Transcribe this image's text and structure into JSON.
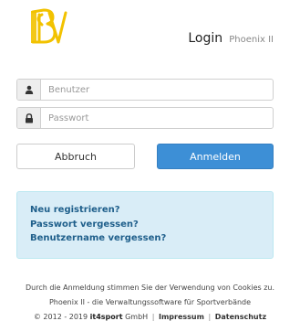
{
  "header": {
    "title": "Login",
    "subtitle": "Phoenix II",
    "logo_name": "bsv-logo"
  },
  "form": {
    "username": {
      "placeholder": "Benutzer",
      "value": "",
      "icon": "user-icon"
    },
    "password": {
      "placeholder": "Passwort",
      "value": "",
      "icon": "lock-icon"
    },
    "cancel_label": "Abbruch",
    "login_label": "Anmelden"
  },
  "links": {
    "register": "Neu registrieren?",
    "forgot_password": "Passwort vergessen?",
    "forgot_username": "Benutzername vergessen?"
  },
  "footer": {
    "cookie_notice": "Durch die Anmeldung stimmen Sie der Verwendung von Cookies zu.",
    "tagline": "Phoenix II - die Verwaltungssoftware für Sportverbände",
    "copyright": "© 2012 - 2019",
    "brand_bold": "it4sport",
    "brand_rest": "GmbH",
    "separator": "|",
    "impressum": "Impressum",
    "datenschutz": "Datenschutz"
  },
  "colors": {
    "primary": "#3d8fd6",
    "info_bg": "#d9edf7",
    "link": "#1f5f8b",
    "logo": "#f2c200"
  }
}
